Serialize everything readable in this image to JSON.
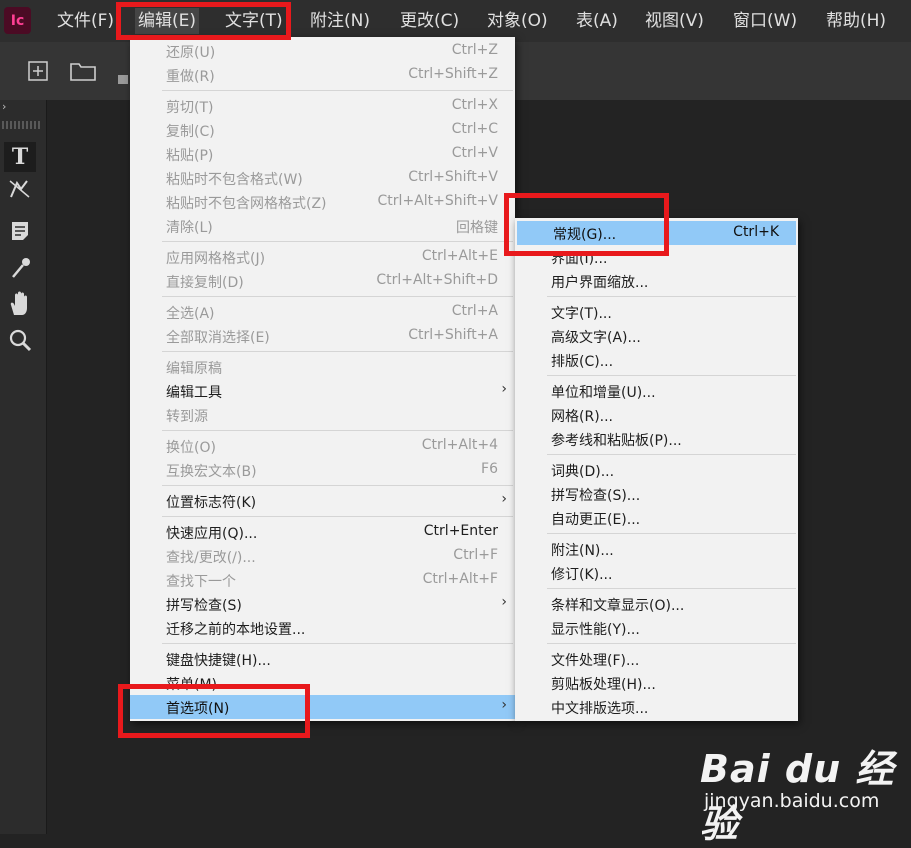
{
  "app": {
    "logo": "Ic"
  },
  "menubar": {
    "items": [
      "文件(F)",
      "编辑(E)",
      "文字(T)",
      "附注(N)",
      "更改(C)",
      "对象(O)",
      "表(A)",
      "视图(V)",
      "窗口(W)",
      "帮助(H)"
    ]
  },
  "edit_menu": {
    "items": [
      {
        "label": "还原(U)",
        "shortcut": "Ctrl+Z"
      },
      {
        "label": "重做(R)",
        "shortcut": "Ctrl+Shift+Z"
      },
      {
        "label": "剪切(T)",
        "shortcut": "Ctrl+X"
      },
      {
        "label": "复制(C)",
        "shortcut": "Ctrl+C"
      },
      {
        "label": "粘贴(P)",
        "shortcut": "Ctrl+V"
      },
      {
        "label": "粘贴时不包含格式(W)",
        "shortcut": "Ctrl+Shift+V"
      },
      {
        "label": "粘贴时不包含网格格式(Z)",
        "shortcut": "Ctrl+Alt+Shift+V"
      },
      {
        "label": "清除(L)",
        "shortcut": "回格键"
      },
      {
        "label": "应用网格格式(J)",
        "shortcut": "Ctrl+Alt+E"
      },
      {
        "label": "直接复制(D)",
        "shortcut": "Ctrl+Alt+Shift+D"
      },
      {
        "label": "全选(A)",
        "shortcut": "Ctrl+A"
      },
      {
        "label": "全部取消选择(E)",
        "shortcut": "Ctrl+Shift+A"
      },
      {
        "label": "编辑原稿",
        "shortcut": ""
      },
      {
        "label": "编辑工具",
        "shortcut": ""
      },
      {
        "label": "转到源",
        "shortcut": ""
      },
      {
        "label": "换位(O)",
        "shortcut": "Ctrl+Alt+4"
      },
      {
        "label": "互换宏文本(B)",
        "shortcut": "F6"
      },
      {
        "label": "位置标志符(K)",
        "shortcut": ""
      },
      {
        "label": "快速应用(Q)...",
        "shortcut": "Ctrl+Enter"
      },
      {
        "label": "查找/更改(/)...",
        "shortcut": "Ctrl+F"
      },
      {
        "label": "查找下一个",
        "shortcut": "Ctrl+Alt+F"
      },
      {
        "label": "拼写检查(S)",
        "shortcut": ""
      },
      {
        "label": "迁移之前的本地设置...",
        "shortcut": ""
      },
      {
        "label": "键盘快捷键(H)...",
        "shortcut": ""
      },
      {
        "label": "菜单(M)...",
        "shortcut": ""
      },
      {
        "label": "首选项(N)",
        "shortcut": ""
      }
    ]
  },
  "prefs_menu": {
    "items": [
      {
        "label": "常规(G)...",
        "shortcut": "Ctrl+K"
      },
      {
        "label": "界面(I)...",
        "shortcut": ""
      },
      {
        "label": "用户界面缩放...",
        "shortcut": ""
      },
      {
        "label": "文字(T)...",
        "shortcut": ""
      },
      {
        "label": "高级文字(A)...",
        "shortcut": ""
      },
      {
        "label": "排版(C)...",
        "shortcut": ""
      },
      {
        "label": "单位和增量(U)...",
        "shortcut": ""
      },
      {
        "label": "网格(R)...",
        "shortcut": ""
      },
      {
        "label": "参考线和粘贴板(P)...",
        "shortcut": ""
      },
      {
        "label": "词典(D)...",
        "shortcut": ""
      },
      {
        "label": "拼写检查(S)...",
        "shortcut": ""
      },
      {
        "label": "自动更正(E)...",
        "shortcut": ""
      },
      {
        "label": "附注(N)...",
        "shortcut": ""
      },
      {
        "label": "修订(K)...",
        "shortcut": ""
      },
      {
        "label": "条样和文章显示(O)...",
        "shortcut": ""
      },
      {
        "label": "显示性能(Y)...",
        "shortcut": ""
      },
      {
        "label": "文件处理(F)...",
        "shortcut": ""
      },
      {
        "label": "剪贴板处理(H)...",
        "shortcut": ""
      },
      {
        "label": "中文排版选项...",
        "shortcut": ""
      }
    ]
  },
  "watermark": {
    "logo": "Bai du 经验",
    "url": "jingyan.baidu.com"
  },
  "colors": {
    "highlight": "#91c9f7",
    "annotation_red": "#e8191c",
    "menu_bg": "#f2f2f2"
  }
}
